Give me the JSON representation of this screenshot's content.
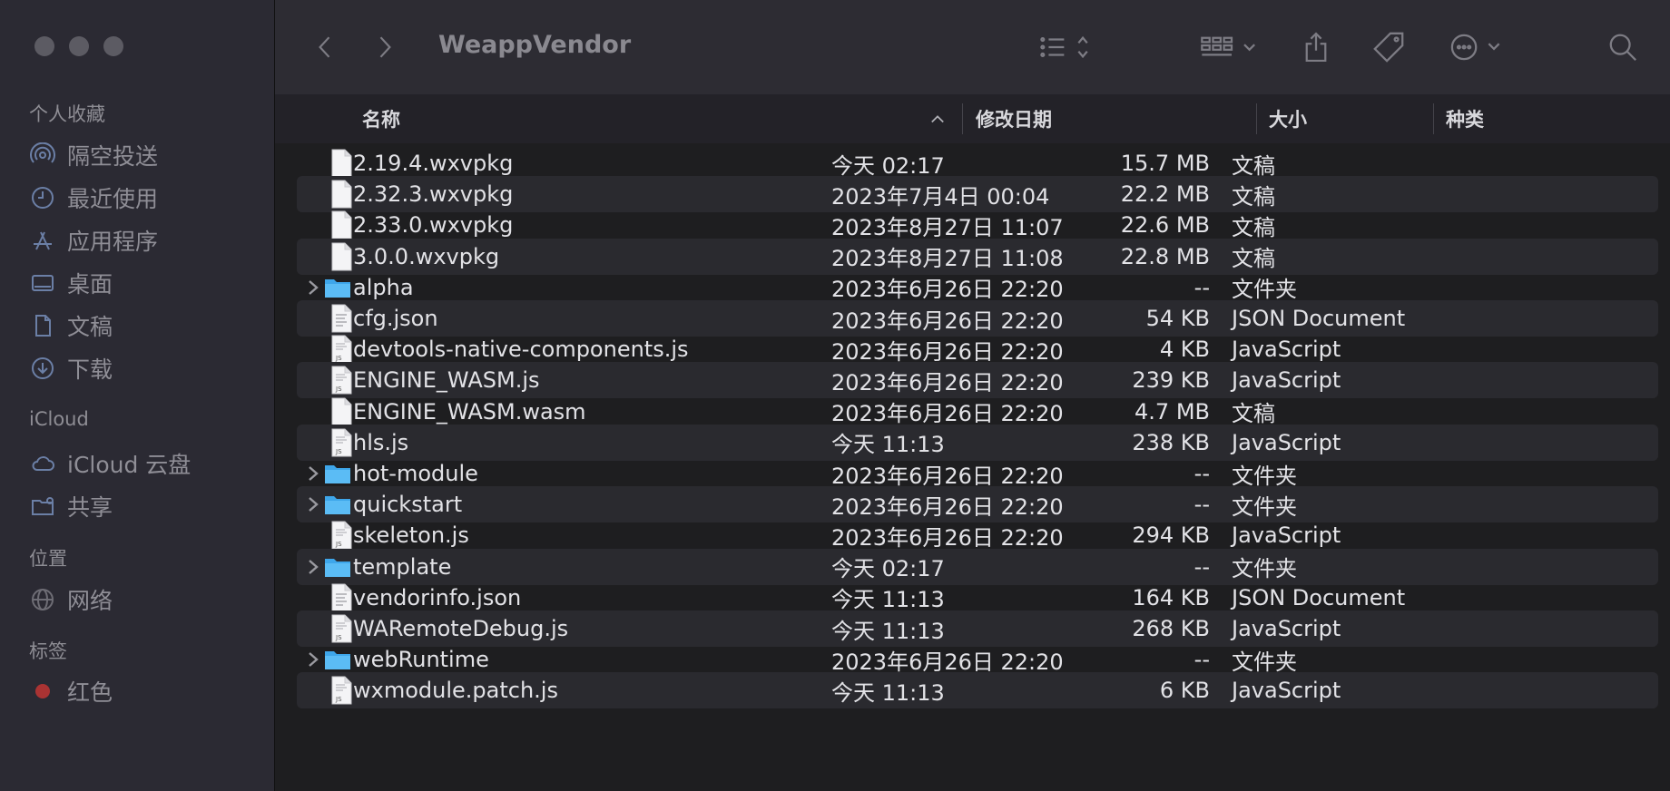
{
  "window": {
    "title": "WeappVendor"
  },
  "sidebar": {
    "favorites_title": "个人收藏",
    "favorites": [
      {
        "label": "隔空投送",
        "icon": "airdrop-icon"
      },
      {
        "label": "最近使用",
        "icon": "clock-icon"
      },
      {
        "label": "应用程序",
        "icon": "applications-icon"
      },
      {
        "label": "桌面",
        "icon": "desktop-icon"
      },
      {
        "label": "文稿",
        "icon": "document-icon"
      },
      {
        "label": "下载",
        "icon": "download-icon"
      }
    ],
    "icloud_title": "iCloud",
    "icloud": [
      {
        "label": "iCloud 云盘",
        "icon": "cloud-icon"
      },
      {
        "label": "共享",
        "icon": "shared-folder-icon"
      }
    ],
    "locations_title": "位置",
    "locations": [
      {
        "label": "网络",
        "icon": "globe-icon"
      }
    ],
    "tags_title": "标签",
    "tags": [
      {
        "label": "红色",
        "color": "#e0443e"
      }
    ]
  },
  "columns": {
    "name": "名称",
    "date": "修改日期",
    "size": "大小",
    "kind": "种类"
  },
  "files": [
    {
      "name": "2.19.4.wxvpkg",
      "date": "今天 02:17",
      "size": "15.7 MB",
      "kind": "文稿",
      "type": "doc"
    },
    {
      "name": "2.32.3.wxvpkg",
      "date": "2023年7月4日 00:04",
      "size": "22.2 MB",
      "kind": "文稿",
      "type": "doc"
    },
    {
      "name": "2.33.0.wxvpkg",
      "date": "2023年8月27日 11:07",
      "size": "22.6 MB",
      "kind": "文稿",
      "type": "doc"
    },
    {
      "name": "3.0.0.wxvpkg",
      "date": "2023年8月27日 11:08",
      "size": "22.8 MB",
      "kind": "文稿",
      "type": "doc"
    },
    {
      "name": "alpha",
      "date": "2023年6月26日 22:20",
      "size": "--",
      "kind": "文件夹",
      "type": "folder"
    },
    {
      "name": "cfg.json",
      "date": "2023年6月26日 22:20",
      "size": "54 KB",
      "kind": "JSON Document",
      "type": "json"
    },
    {
      "name": "devtools-native-components.js",
      "date": "2023年6月26日 22:20",
      "size": "4 KB",
      "kind": "JavaScript",
      "type": "js"
    },
    {
      "name": "ENGINE_WASM.js",
      "date": "2023年6月26日 22:20",
      "size": "239 KB",
      "kind": "JavaScript",
      "type": "js"
    },
    {
      "name": "ENGINE_WASM.wasm",
      "date": "2023年6月26日 22:20",
      "size": "4.7 MB",
      "kind": "文稿",
      "type": "doc"
    },
    {
      "name": "hls.js",
      "date": "今天 11:13",
      "size": "238 KB",
      "kind": "JavaScript",
      "type": "js"
    },
    {
      "name": "hot-module",
      "date": "2023年6月26日 22:20",
      "size": "--",
      "kind": "文件夹",
      "type": "folder"
    },
    {
      "name": "quickstart",
      "date": "2023年6月26日 22:20",
      "size": "--",
      "kind": "文件夹",
      "type": "folder"
    },
    {
      "name": "skeleton.js",
      "date": "2023年6月26日 22:20",
      "size": "294 KB",
      "kind": "JavaScript",
      "type": "js"
    },
    {
      "name": "template",
      "date": "今天 02:17",
      "size": "--",
      "kind": "文件夹",
      "type": "folder"
    },
    {
      "name": "vendorinfo.json",
      "date": "今天 11:13",
      "size": "164 KB",
      "kind": "JSON Document",
      "type": "json"
    },
    {
      "name": "WARemoteDebug.js",
      "date": "今天 11:13",
      "size": "268 KB",
      "kind": "JavaScript",
      "type": "js"
    },
    {
      "name": "webRuntime",
      "date": "2023年6月26日 22:20",
      "size": "--",
      "kind": "文件夹",
      "type": "folder"
    },
    {
      "name": "wxmodule.patch.js",
      "date": "今天 11:13",
      "size": "6 KB",
      "kind": "JavaScript",
      "type": "js"
    }
  ]
}
